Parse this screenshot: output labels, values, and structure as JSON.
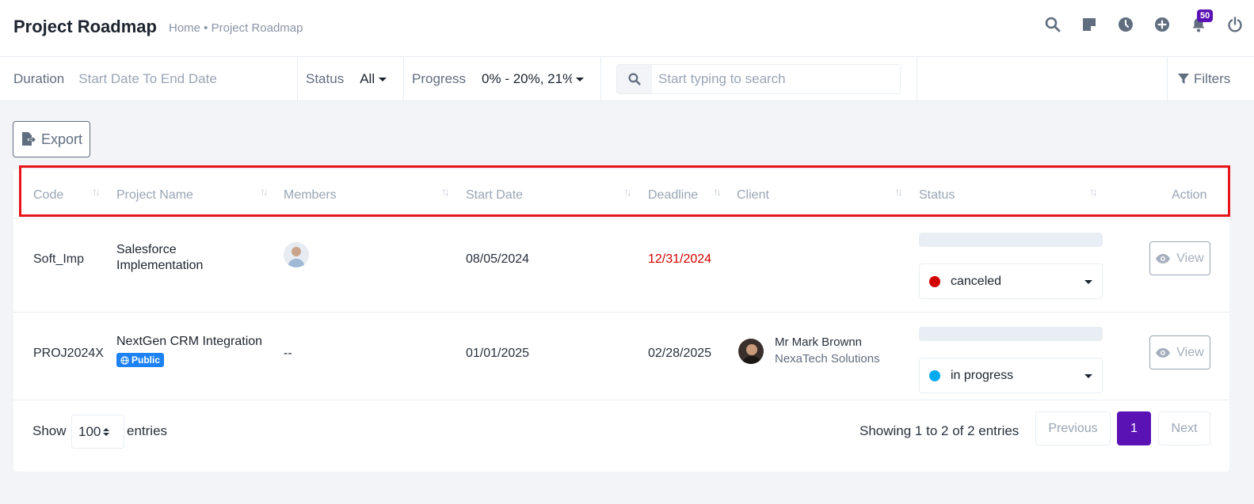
{
  "header": {
    "title": "Project Roadmap",
    "breadcrumb": "Home • Project Roadmap",
    "icons": [
      "search-icon",
      "sticky-note-icon",
      "clock-icon",
      "plus-circle-icon",
      "bell-icon",
      "power-icon"
    ],
    "notification_count": "50",
    "accent": "#5b12b5"
  },
  "filters": {
    "duration_label": "Duration",
    "duration_placeholder": "Start Date To End Date",
    "status_label": "Status",
    "status_value": "All",
    "progress_label": "Progress",
    "progress_value": "0% - 20%, 21%",
    "search_placeholder": "Start typing to search",
    "filters_label": "Filters"
  },
  "toolbar": {
    "export_label": "Export"
  },
  "table": {
    "columns": [
      "Code",
      "Project Name",
      "Members",
      "Start Date",
      "Deadline",
      "Client",
      "Status",
      "Action"
    ],
    "rows": [
      {
        "code": "Soft_Imp",
        "name_line1": "Salesforce",
        "name_line2": "Implementation",
        "members": "",
        "start_date": "08/05/2024",
        "deadline": "12/31/2024",
        "client_name": "",
        "client_company": "",
        "status": "canceled",
        "status_color": "#d30000",
        "action": "View"
      },
      {
        "code": "PROJ2024X",
        "name_line1": "NextGen CRM Integration",
        "badge": "Public",
        "members": "--",
        "start_date": "01/01/2025",
        "deadline": "02/28/2025",
        "client_name": "Mr Mark Brownn",
        "client_company": "NexaTech Solutions",
        "status": "in progress",
        "status_color": "#00aaf0",
        "action": "View"
      }
    ]
  },
  "footer": {
    "show_label": "Show",
    "entries_value": "100",
    "entries_label": "entries",
    "summary": "Showing 1 to 2 of 2 entries",
    "prev_label": "Previous",
    "page": "1",
    "next_label": "Next"
  }
}
